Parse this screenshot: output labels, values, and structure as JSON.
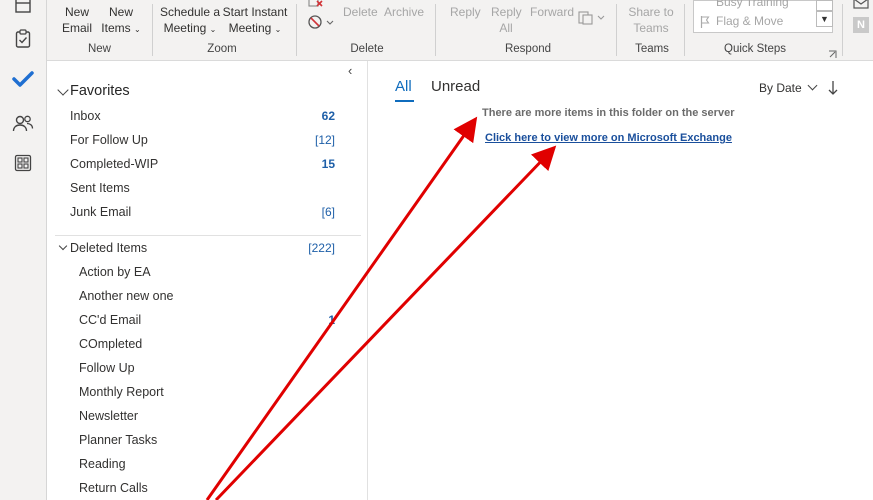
{
  "ribbon": {
    "new_group": {
      "new_email_line1": "New",
      "new_email_line2": "Email",
      "new_items_line1": "New",
      "new_items_line2": "Items",
      "label": "New"
    },
    "zoom_group": {
      "schedule_line1": "Schedule a",
      "schedule_line2": "Meeting",
      "instant_line1": "Start Instant",
      "instant_line2": "Meeting",
      "label": "Zoom"
    },
    "delete_group": {
      "delete": "Delete",
      "archive": "Archive",
      "label": "Delete"
    },
    "respond_group": {
      "reply": "Reply",
      "reply_all_line1": "Reply",
      "reply_all_line2": "All",
      "forward": "Forward",
      "label": "Respond"
    },
    "teams_group": {
      "share_line1": "Share to",
      "share_line2": "Teams",
      "label": "Teams"
    },
    "quick_steps": {
      "item1": "Busy Training",
      "item2": "Flag & Move",
      "label": "Quick Steps"
    }
  },
  "folders": {
    "favorites_header": "Favorites",
    "favorites": [
      {
        "name": "Inbox",
        "count": "62"
      },
      {
        "name": "For Follow Up",
        "count": "[12]"
      },
      {
        "name": "Completed-WIP",
        "count": "15"
      },
      {
        "name": "Sent Items",
        "count": ""
      },
      {
        "name": "Junk Email",
        "count": "[6]"
      }
    ],
    "deleted_header": "Deleted Items",
    "deleted_count": "[222]",
    "deleted_children": [
      {
        "name": "Action by EA",
        "count": ""
      },
      {
        "name": "Another new one",
        "count": ""
      },
      {
        "name": "CC'd Email",
        "count": "1"
      },
      {
        "name": "COmpleted",
        "count": ""
      },
      {
        "name": "Follow Up",
        "count": ""
      },
      {
        "name": "Monthly Report",
        "count": ""
      },
      {
        "name": "Newsletter",
        "count": ""
      },
      {
        "name": "Planner Tasks",
        "count": ""
      },
      {
        "name": "Reading",
        "count": ""
      },
      {
        "name": "Return Calls",
        "count": ""
      }
    ]
  },
  "message_list": {
    "tab_all": "All",
    "tab_unread": "Unread",
    "sort_label": "By Date",
    "server_notice": "There are more items in this folder on the server",
    "exchange_link": "Click here to view more on Microsoft Exchange"
  },
  "colors": {
    "accent": "#0f6cbd",
    "annotation_arrow": "#e00000",
    "link": "#1a4f9c"
  }
}
